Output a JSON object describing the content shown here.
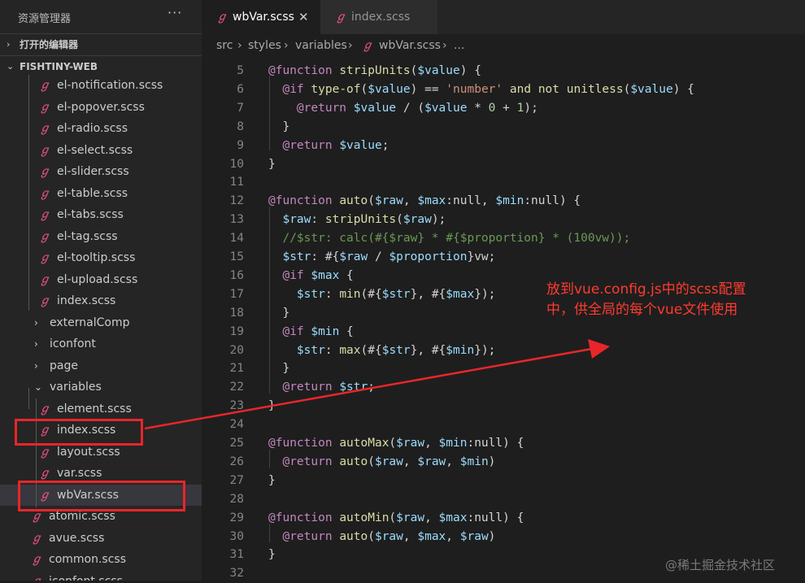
{
  "sidebar": {
    "title": "资源管理器",
    "more": "···",
    "open_editors": "打开的编辑器",
    "project": "FISHTINY-WEB",
    "items": [
      {
        "name": "el-notification.scss",
        "type": "file",
        "depth": 2
      },
      {
        "name": "el-popover.scss",
        "type": "file",
        "depth": 2
      },
      {
        "name": "el-radio.scss",
        "type": "file",
        "depth": 2
      },
      {
        "name": "el-select.scss",
        "type": "file",
        "depth": 2
      },
      {
        "name": "el-slider.scss",
        "type": "file",
        "depth": 2
      },
      {
        "name": "el-table.scss",
        "type": "file",
        "depth": 2
      },
      {
        "name": "el-tabs.scss",
        "type": "file",
        "depth": 2
      },
      {
        "name": "el-tag.scss",
        "type": "file",
        "depth": 2
      },
      {
        "name": "el-tooltip.scss",
        "type": "file",
        "depth": 2
      },
      {
        "name": "el-upload.scss",
        "type": "file",
        "depth": 2
      },
      {
        "name": "index.scss",
        "type": "file",
        "depth": 2
      },
      {
        "name": "externalComp",
        "type": "folder",
        "depth": 1,
        "open": false
      },
      {
        "name": "iconfont",
        "type": "folder",
        "depth": 1,
        "open": false
      },
      {
        "name": "page",
        "type": "folder",
        "depth": 1,
        "open": false
      },
      {
        "name": "variables",
        "type": "folder",
        "depth": 1,
        "open": true
      },
      {
        "name": "element.scss",
        "type": "file",
        "depth": 2
      },
      {
        "name": "index.scss",
        "type": "file",
        "depth": 2
      },
      {
        "name": "layout.scss",
        "type": "file",
        "depth": 2
      },
      {
        "name": "var.scss",
        "type": "file",
        "depth": 2
      },
      {
        "name": "wbVar.scss",
        "type": "file",
        "depth": 2,
        "selected": true
      },
      {
        "name": "atomic.scss",
        "type": "file",
        "depth": 1
      },
      {
        "name": "avue.scss",
        "type": "file",
        "depth": 1
      },
      {
        "name": "common.scss",
        "type": "file",
        "depth": 1
      },
      {
        "name": "iconfont.scss",
        "type": "file",
        "depth": 1
      }
    ]
  },
  "tabs": [
    {
      "label": "wbVar.scss",
      "active": true,
      "close": "✕"
    },
    {
      "label": "index.scss",
      "active": false
    }
  ],
  "breadcrumb": {
    "parts": [
      "src",
      "styles",
      "variables",
      "wbVar.scss",
      "..."
    ],
    "separator": "›"
  },
  "editor": {
    "lines": [
      {
        "num": "5",
        "html": "<span class='k'>@function</span> <span class='fn'>stripUnits</span>(<span class='v'>$value</span>) {"
      },
      {
        "num": "6",
        "html": "  <span class='k'>@if</span> <span class='fn'>type-of</span>(<span class='v'>$value</span>) == <span class='s'>'number'</span> <span class='fn'>and</span> <span class='fn'>not</span> <span class='fn'>unitless</span>(<span class='v'>$value</span>) {"
      },
      {
        "num": "7",
        "html": "    <span class='k'>@return</span> <span class='v'>$value</span> / (<span class='v'>$value</span> * <span class='n'>0</span> + <span class='n'>1</span>);"
      },
      {
        "num": "8",
        "html": "  }"
      },
      {
        "num": "9",
        "html": "  <span class='k'>@return</span> <span class='v'>$value</span>;"
      },
      {
        "num": "10",
        "html": "}"
      },
      {
        "num": "11",
        "html": ""
      },
      {
        "num": "12",
        "html": "<span class='k'>@function</span> <span class='fn'>auto</span>(<span class='v'>$raw</span>, <span class='v'>$max</span>:null, <span class='v'>$min</span>:null) {"
      },
      {
        "num": "13",
        "html": "  <span class='v'>$raw</span>: <span class='fn'>stripUnits</span>(<span class='v'>$raw</span>);"
      },
      {
        "num": "14",
        "html": "  <span class='c'>//$str: calc(#{$raw} * #{$proportion} * (100vw));</span>"
      },
      {
        "num": "15",
        "html": "  <span class='v'>$str</span>: #{<span class='v'>$raw</span> / <span class='v'>$proportion</span>}vw;"
      },
      {
        "num": "16",
        "html": "  <span class='k'>@if</span> <span class='v'>$max</span> {"
      },
      {
        "num": "17",
        "html": "    <span class='v'>$str</span>: <span class='fn'>min</span>(#{<span class='v'>$str</span>}, #{<span class='v'>$max</span>});"
      },
      {
        "num": "18",
        "html": "  }"
      },
      {
        "num": "19",
        "html": "  <span class='k'>@if</span> <span class='v'>$min</span> {"
      },
      {
        "num": "20",
        "html": "    <span class='v'>$str</span>: <span class='fn'>max</span>(#{<span class='v'>$str</span>}, #{<span class='v'>$min</span>});"
      },
      {
        "num": "21",
        "html": "  }"
      },
      {
        "num": "22",
        "html": "  <span class='k'>@return</span> <span class='v'>$str</span>;"
      },
      {
        "num": "23",
        "html": "}"
      },
      {
        "num": "24",
        "html": ""
      },
      {
        "num": "25",
        "html": "<span class='k'>@function</span> <span class='fn'>autoMax</span>(<span class='v'>$raw</span>, <span class='v'>$min</span>:null) {"
      },
      {
        "num": "26",
        "html": "  <span class='k'>@return</span> <span class='fn'>auto</span>(<span class='v'>$raw</span>, <span class='v'>$raw</span>, <span class='v'>$min</span>)"
      },
      {
        "num": "27",
        "html": "}"
      },
      {
        "num": "28",
        "html": ""
      },
      {
        "num": "29",
        "html": "<span class='k'>@function</span> <span class='fn'>autoMin</span>(<span class='v'>$raw</span>, <span class='v'>$max</span>:null) {"
      },
      {
        "num": "30",
        "html": "  <span class='k'>@return</span> <span class='fn'>auto</span>(<span class='v'>$raw</span>, <span class='v'>$max</span>, <span class='v'>$raw</span>)"
      },
      {
        "num": "31",
        "html": "}"
      },
      {
        "num": "32",
        "html": ""
      }
    ]
  },
  "annotation": {
    "line1": "放到vue.config.js中的scss配置",
    "line2": "中，供全局的每个vue文件使用"
  },
  "watermark": "@稀土掘金技术社区",
  "colors": {
    "highlight": "#e8262a",
    "scss_icon": "#f55385"
  }
}
